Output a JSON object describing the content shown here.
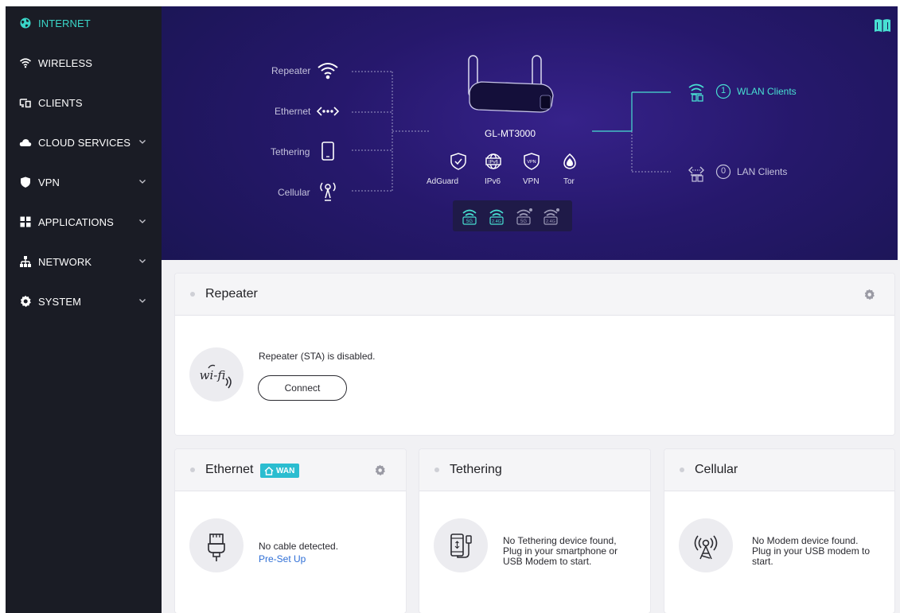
{
  "sidebar": {
    "items": [
      {
        "label": "INTERNET",
        "icon": "globe-icon",
        "active": true,
        "expandable": false
      },
      {
        "label": "WIRELESS",
        "icon": "wifi-icon",
        "active": false,
        "expandable": false
      },
      {
        "label": "CLIENTS",
        "icon": "devices-icon",
        "active": false,
        "expandable": false
      },
      {
        "label": "CLOUD SERVICES",
        "icon": "cloud-icon",
        "active": false,
        "expandable": true
      },
      {
        "label": "VPN",
        "icon": "shield-icon",
        "active": false,
        "expandable": true
      },
      {
        "label": "APPLICATIONS",
        "icon": "grid-icon",
        "active": false,
        "expandable": true
      },
      {
        "label": "NETWORK",
        "icon": "network-icon",
        "active": false,
        "expandable": true
      },
      {
        "label": "SYSTEM",
        "icon": "gear-icon",
        "active": false,
        "expandable": true
      }
    ]
  },
  "hero": {
    "sources": [
      {
        "label": "Repeater",
        "icon": "wifi-icon"
      },
      {
        "label": "Ethernet",
        "icon": "ethernet-arrows-icon"
      },
      {
        "label": "Tethering",
        "icon": "phone-icon"
      },
      {
        "label": "Cellular",
        "icon": "cellular-tower-icon"
      }
    ],
    "router_name": "GL-MT3000",
    "features": [
      {
        "label": "AdGuard",
        "icon": "adguard-shield-icon"
      },
      {
        "label": "IPv6",
        "icon": "ipv6-globe-icon"
      },
      {
        "label": "VPN",
        "icon": "vpn-shield-icon"
      },
      {
        "label": "Tor",
        "icon": "tor-onion-icon"
      }
    ],
    "wifi_bands": [
      {
        "band": "5G",
        "enabled": true
      },
      {
        "band": "2.4G",
        "enabled": true
      },
      {
        "band": "5G",
        "enabled": false
      },
      {
        "band": "2.4G",
        "enabled": false
      }
    ],
    "wlan_clients": {
      "count": "1",
      "label": "WLAN Clients"
    },
    "lan_clients": {
      "count": "0",
      "label": "LAN Clients"
    },
    "guide_icon": "book-icon",
    "accent_color": "#48e0d2"
  },
  "repeater": {
    "title": "Repeater",
    "message": "Repeater (STA) is disabled.",
    "button": "Connect",
    "icon_text": "wi-fi"
  },
  "ethernet": {
    "title": "Ethernet",
    "badge": "WAN",
    "message": "No cable detected.",
    "link": "Pre-Set Up"
  },
  "tethering": {
    "title": "Tethering",
    "message_lines": [
      "No Tethering device found,",
      "Plug in your smartphone or",
      "USB Modem to start."
    ]
  },
  "cellular": {
    "title": "Cellular",
    "message_lines": [
      "No Modem device found.",
      "Plug in your USB modem to",
      "start."
    ]
  }
}
